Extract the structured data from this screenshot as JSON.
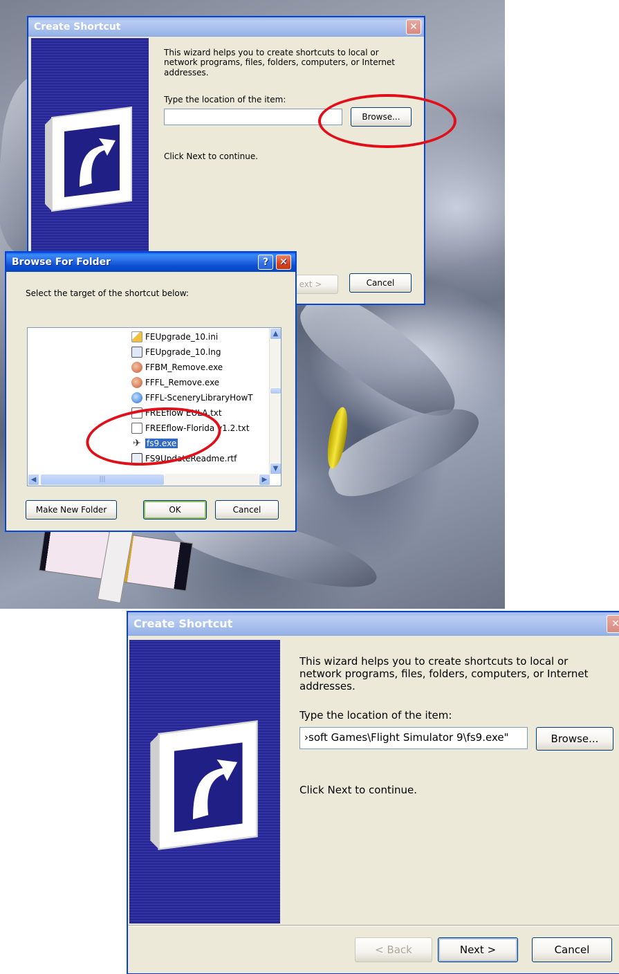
{
  "top_wizard": {
    "title": "Create Shortcut",
    "intro": "This wizard helps you to create shortcuts to local or network programs, files, folders, computers, or Internet addresses.",
    "location_label": "Type the location of the item:",
    "location_value": "",
    "browse_label": "Browse...",
    "continue_text": "Click Next to continue.",
    "next_label": "ext >",
    "cancel_label": "Cancel"
  },
  "browse_dialog": {
    "title": "Browse For Folder",
    "instruction": "Select the target of the shortcut below:",
    "help_symbol": "?",
    "close_symbol": "✕",
    "files": [
      {
        "name": "FEUpgrade_10.ini",
        "icon": "ini-file-icon",
        "selected": false
      },
      {
        "name": "FEUpgrade_10.lng",
        "icon": "lng-file-icon",
        "selected": false
      },
      {
        "name": "FFBM_Remove.exe",
        "icon": "remove-exe-icon",
        "selected": false
      },
      {
        "name": "FFFL_Remove.exe",
        "icon": "remove-exe-icon",
        "selected": false
      },
      {
        "name": "FFFL-SceneryLibraryHowT",
        "icon": "html-file-icon",
        "selected": false
      },
      {
        "name": "FREEflow EULA.txt",
        "icon": "text-file-icon",
        "selected": false
      },
      {
        "name": "FREEflow-Florida v1.2.txt",
        "icon": "text-file-icon",
        "selected": false
      },
      {
        "name": "fs9.exe",
        "icon": "airplane-icon",
        "selected": true
      },
      {
        "name": "FS9UpdateReadme.rtf",
        "icon": "rtf-file-icon",
        "selected": false
      }
    ],
    "scroll_thumb_grip": "|||",
    "make_new_folder_label": "Make New Folder",
    "ok_label": "OK",
    "cancel_label": "Cancel"
  },
  "bottom_wizard": {
    "title": "Create Shortcut",
    "intro": "This wizard helps you to create shortcuts to local or network programs, files, folders, computers, or Internet addresses.",
    "location_label": "Type the location of the item:",
    "location_value": "›soft Games\\Flight Simulator 9\\fs9.exe\"",
    "browse_label": "Browse...",
    "continue_text": "Click Next to continue.",
    "back_label": "< Back",
    "next_label": "Next >",
    "cancel_label": "Cancel"
  },
  "colors": {
    "annotation_ring": "#e0101a",
    "xp_title_blue": "#0b4fd1",
    "dialog_face": "#ece9d8",
    "selection": "#316ac5"
  }
}
